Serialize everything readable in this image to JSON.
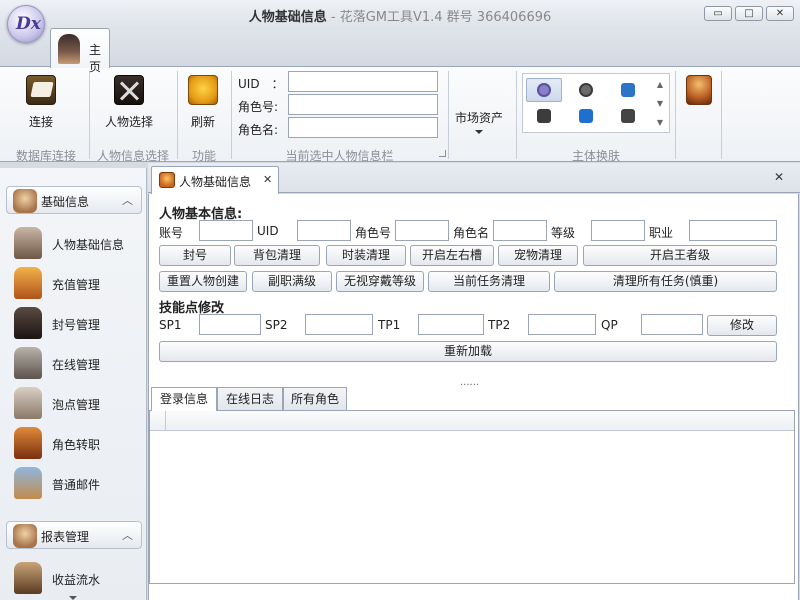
{
  "window": {
    "title_main": "人物基础信息",
    "title_sub": " - 花落GM工具V1.4 群号 366406696",
    "logo_text": "Dx",
    "controls": {
      "minimize": "▭",
      "maximize": "□",
      "close": "✕"
    }
  },
  "ribbon": {
    "home_tab": "主页",
    "groups": {
      "db": {
        "caption": "数据库连接",
        "connect": "连接"
      },
      "info": {
        "caption": "人物信息选择",
        "select": "人物选择"
      },
      "func": {
        "caption": "功能",
        "refresh": "刷新"
      },
      "current": {
        "caption": "当前选中人物信息栏",
        "uid_label": "UID　：",
        "role_id_label": "角色号:",
        "role_name_label": "角色名:",
        "uid_value": "",
        "role_id_value": "",
        "role_name_value": ""
      },
      "market": {
        "label": "市场资产"
      },
      "skin": {
        "caption": "主体换肤"
      }
    }
  },
  "nav": {
    "sections": [
      {
        "title": "基础信息",
        "items": [
          {
            "label": "人物基础信息"
          },
          {
            "label": "充值管理"
          },
          {
            "label": "封号管理"
          },
          {
            "label": "在线管理"
          },
          {
            "label": "泡点管理"
          },
          {
            "label": "角色转职"
          },
          {
            "label": "普通邮件"
          }
        ]
      },
      {
        "title": "报表管理",
        "items": [
          {
            "label": "收益流水"
          }
        ]
      }
    ]
  },
  "doc": {
    "tab_label": "人物基础信息",
    "close_glyph": "✕",
    "basic": {
      "title": "人物基本信息:",
      "labels": {
        "account": "账号",
        "uid": "UID",
        "role_id": "角色号",
        "role_name": "角色名",
        "level": "等级",
        "job": "职业"
      },
      "values": {
        "account": "",
        "uid": "",
        "role_id": "",
        "role_name": "",
        "level": "",
        "job": ""
      }
    },
    "buttons_row1": [
      "封号",
      "背包清理",
      "时装清理",
      "开启左右槽",
      "宠物清理",
      "开启王者级"
    ],
    "buttons_row2": [
      "重置人物创建",
      "副职满级",
      "无视穿戴等级",
      "当前任务清理",
      "清理所有任务(慎重)"
    ],
    "skill": {
      "title": "技能点修改",
      "labels": {
        "sp1": "SP1",
        "sp2": "SP2",
        "tp1": "TP1",
        "tp2": "TP2",
        "qp": "QP"
      },
      "values": {
        "sp1": "",
        "sp2": "",
        "tp1": "",
        "tp2": "",
        "qp": ""
      },
      "modify": "修改"
    },
    "reload": "重新加载",
    "splitter": "......",
    "subtabs": [
      "登录信息",
      "在线日志",
      "所有角色"
    ]
  }
}
